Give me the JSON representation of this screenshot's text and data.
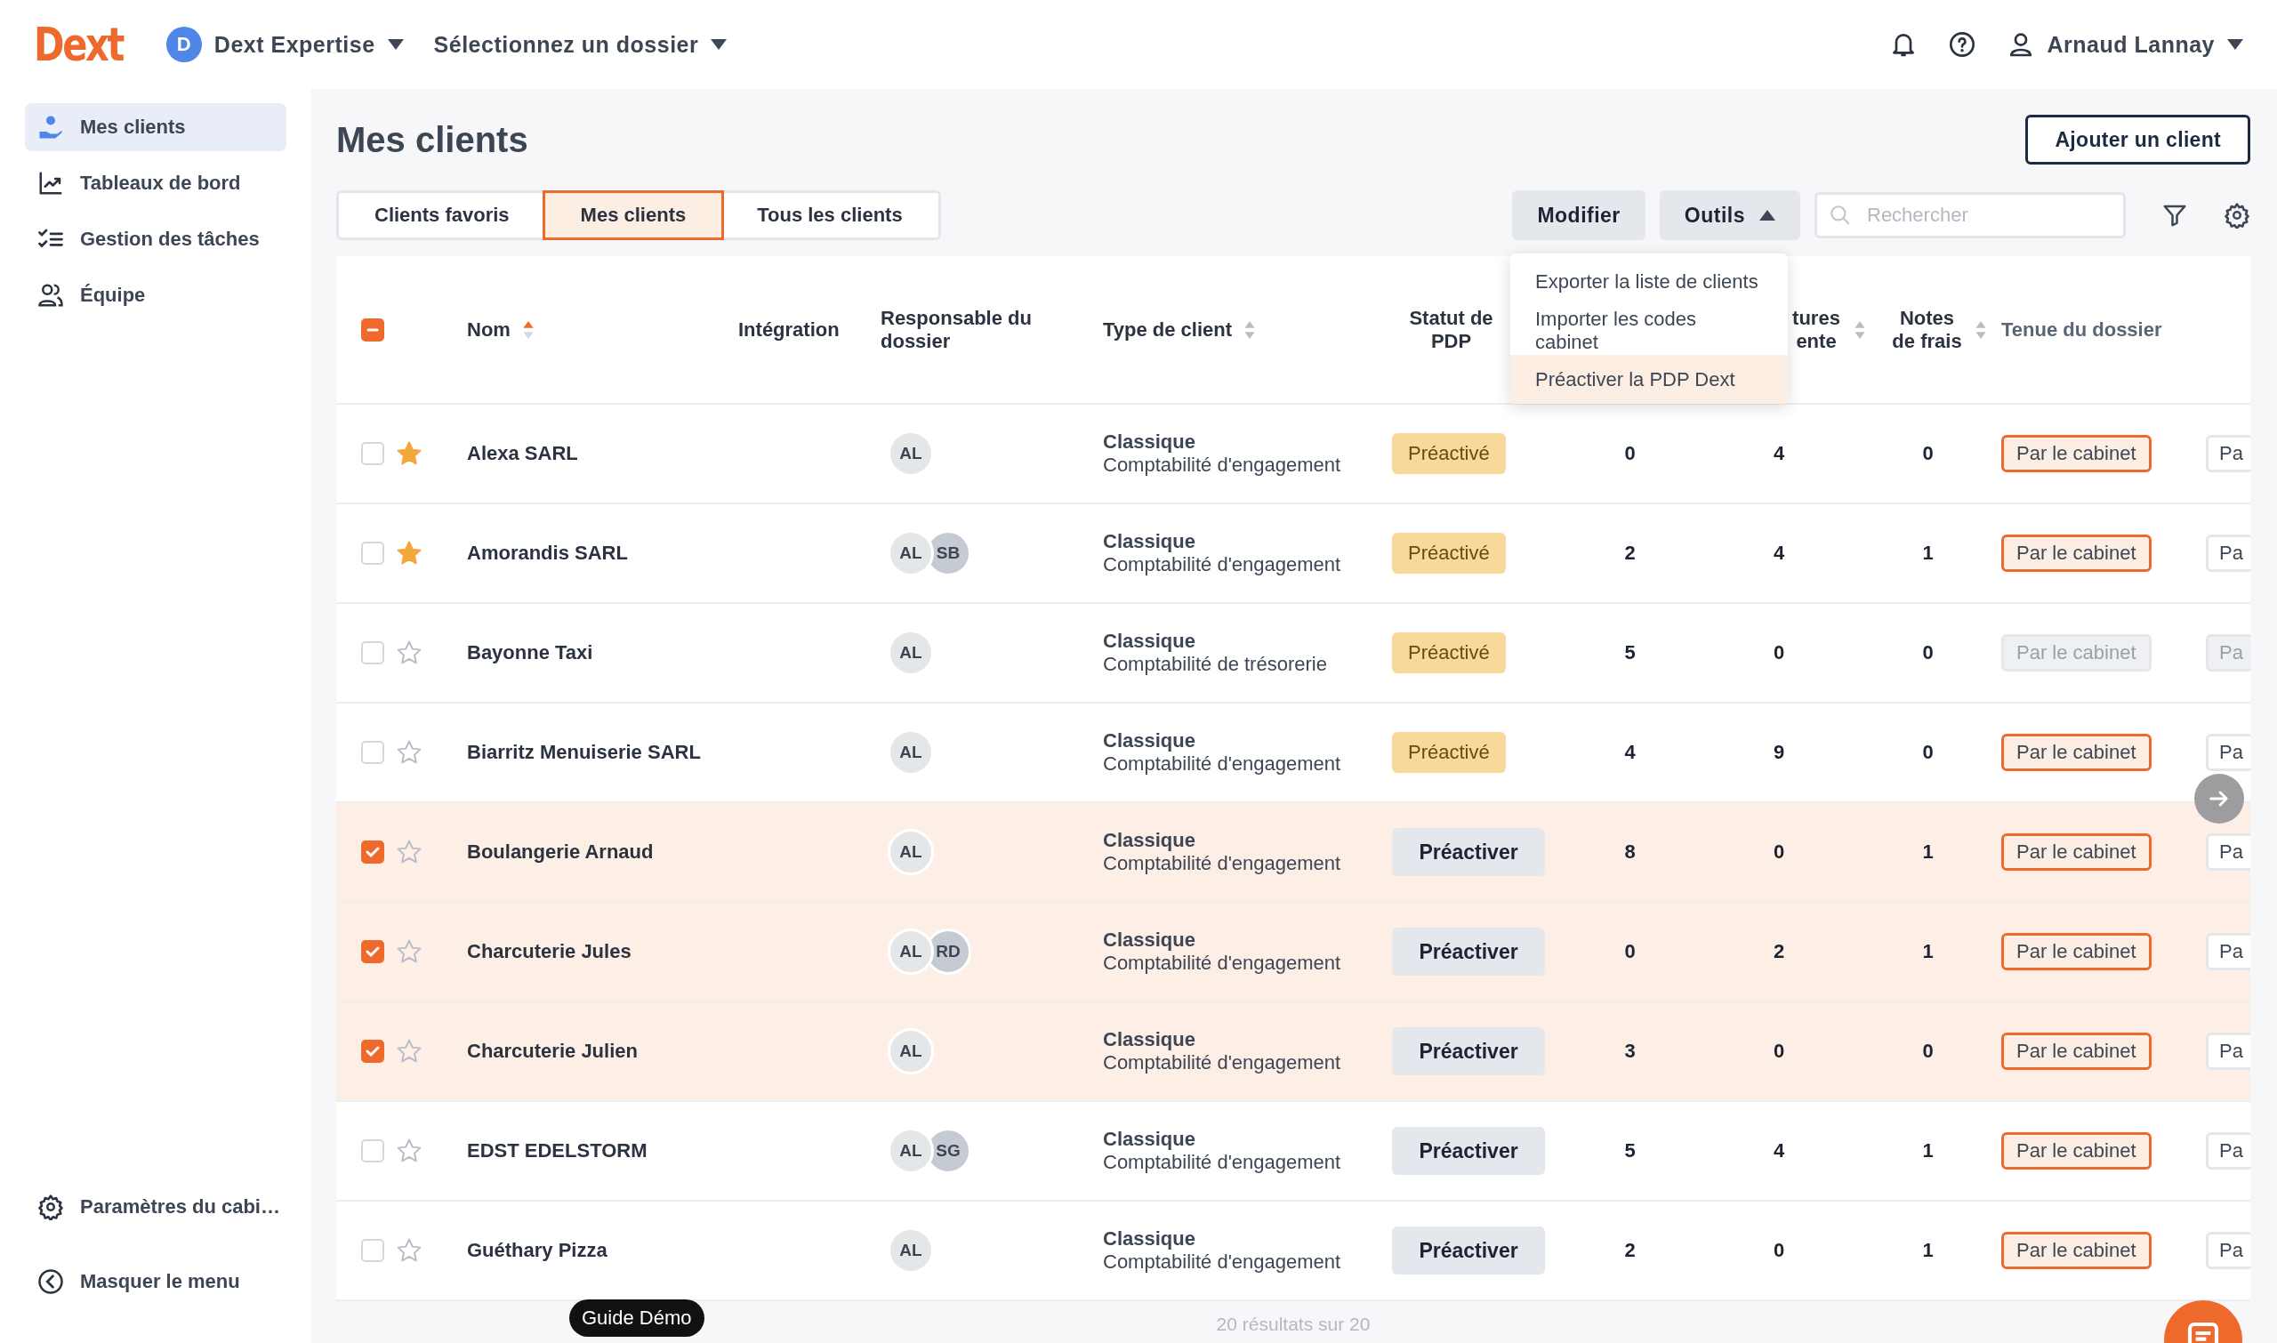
{
  "header": {
    "logo": "Dext",
    "org": {
      "initial": "D",
      "name": "Dext Expertise"
    },
    "folder_select": "Sélectionnez un dossier",
    "user": "Arnaud Lannay"
  },
  "sidebar": {
    "items": [
      {
        "label": "Mes clients",
        "selected": true
      },
      {
        "label": "Tableaux de bord",
        "selected": false
      },
      {
        "label": "Gestion des tâches",
        "selected": false
      },
      {
        "label": "Équipe",
        "selected": false
      }
    ],
    "bottom_items": [
      {
        "label": "Paramètres du cabi…"
      },
      {
        "label": "Masquer le menu"
      }
    ]
  },
  "page": {
    "title": "Mes clients",
    "add_button": "Ajouter un client"
  },
  "tabs": [
    {
      "label": "Clients favoris",
      "selected": false
    },
    {
      "label": "Mes clients",
      "selected": true
    },
    {
      "label": "Tous les clients",
      "selected": false
    }
  ],
  "toolbar": {
    "edit_button": "Modifier",
    "tools_button": {
      "label": "Outils",
      "expanded": true
    },
    "search": {
      "placeholder": "Rechercher"
    }
  },
  "tools_menu": [
    {
      "label": "Exporter la liste de clients",
      "selected": false
    },
    {
      "label": "Importer les codes cabinet",
      "selected": false
    },
    {
      "label": "Préactiver la PDP Dext",
      "selected": true
    }
  ],
  "table": {
    "select_all": {
      "indeterminate": true
    },
    "columns": [
      {
        "label": "Nom",
        "sortable": true,
        "sorted": true
      },
      {
        "label": "Intégration",
        "sortable": false
      },
      {
        "label": "Responsable du dossier",
        "sortable": false
      },
      {
        "label": "Type de client",
        "sortable": true,
        "sorted": false
      },
      {
        "label": "Statut de PDP",
        "sortable": false
      },
      {
        "label": "tures ente",
        "sortable": true,
        "sorted": false
      },
      {
        "label": "Notes de frais",
        "sortable": true,
        "sorted": false
      },
      {
        "label": "Tenue du dossier",
        "sortable": false
      }
    ],
    "rows": [
      {
        "name": "Alexa SARL",
        "favorite": true,
        "selected": false,
        "owners": [
          "AL"
        ],
        "type": "Classique",
        "subtype": "Comptabilité d'engagement",
        "pdp": {
          "kind": "badge",
          "label": "Préactivé"
        },
        "col_6": "0",
        "col_7": "4",
        "col_8": "0",
        "tenue": {
          "label": "Par le cabinet",
          "disabled": false
        },
        "col_10": "Pa"
      },
      {
        "name": "Amorandis SARL",
        "favorite": true,
        "selected": false,
        "owners": [
          "AL",
          "SB"
        ],
        "type": "Classique",
        "subtype": "Comptabilité d'engagement",
        "pdp": {
          "kind": "badge",
          "label": "Préactivé"
        },
        "col_6": "2",
        "col_7": "4",
        "col_8": "1",
        "tenue": {
          "label": "Par le cabinet",
          "disabled": false
        },
        "col_10": "Pa"
      },
      {
        "name": "Bayonne Taxi",
        "favorite": false,
        "selected": false,
        "owners": [
          "AL"
        ],
        "type": "Classique",
        "subtype": "Comptabilité de trésorerie",
        "pdp": {
          "kind": "badge",
          "label": "Préactivé"
        },
        "col_6": "5",
        "col_7": "0",
        "col_8": "0",
        "tenue": {
          "label": "Par le cabinet",
          "disabled": true
        },
        "col_10": "Pa"
      },
      {
        "name": "Biarritz Menuiserie SARL",
        "favorite": false,
        "selected": false,
        "owners": [
          "AL"
        ],
        "type": "Classique",
        "subtype": "Comptabilité d'engagement",
        "pdp": {
          "kind": "badge",
          "label": "Préactivé"
        },
        "col_6": "4",
        "col_7": "9",
        "col_8": "0",
        "tenue": {
          "label": "Par le cabinet",
          "disabled": false
        },
        "col_10": "Pa"
      },
      {
        "name": "Boulangerie Arnaud",
        "favorite": false,
        "selected": true,
        "owners": [
          "AL"
        ],
        "type": "Classique",
        "subtype": "Comptabilité d'engagement",
        "pdp": {
          "kind": "button",
          "label": "Préactiver"
        },
        "col_6": "8",
        "col_7": "0",
        "col_8": "1",
        "tenue": {
          "label": "Par le cabinet",
          "disabled": false
        },
        "col_10": "Pa"
      },
      {
        "name": "Charcuterie Jules",
        "favorite": false,
        "selected": true,
        "owners": [
          "AL",
          "RD"
        ],
        "type": "Classique",
        "subtype": "Comptabilité d'engagement",
        "pdp": {
          "kind": "button",
          "label": "Préactiver"
        },
        "col_6": "0",
        "col_7": "2",
        "col_8": "1",
        "tenue": {
          "label": "Par le cabinet",
          "disabled": false
        },
        "col_10": "Pa"
      },
      {
        "name": "Charcuterie Julien",
        "favorite": false,
        "selected": true,
        "owners": [
          "AL"
        ],
        "type": "Classique",
        "subtype": "Comptabilité d'engagement",
        "pdp": {
          "kind": "button",
          "label": "Préactiver"
        },
        "col_6": "3",
        "col_7": "0",
        "col_8": "0",
        "tenue": {
          "label": "Par le cabinet",
          "disabled": false
        },
        "col_10": "Pa"
      },
      {
        "name": "EDST EDELSTORM",
        "favorite": false,
        "selected": false,
        "owners": [
          "AL",
          "SG"
        ],
        "type": "Classique",
        "subtype": "Comptabilité d'engagement",
        "pdp": {
          "kind": "button",
          "label": "Préactiver"
        },
        "col_6": "5",
        "col_7": "4",
        "col_8": "1",
        "tenue": {
          "label": "Par le cabinet",
          "disabled": false
        },
        "col_10": "Pa"
      },
      {
        "name": "Guéthary Pizza",
        "favorite": false,
        "selected": false,
        "owners": [
          "AL"
        ],
        "type": "Classique",
        "subtype": "Comptabilité d'engagement",
        "pdp": {
          "kind": "button",
          "label": "Préactiver"
        },
        "col_6": "2",
        "col_7": "0",
        "col_8": "1",
        "tenue": {
          "label": "Par le cabinet",
          "disabled": false
        },
        "col_10": "Pa"
      }
    ],
    "footer": "20 résultats sur 20"
  },
  "guide_button": "Guide Démo"
}
